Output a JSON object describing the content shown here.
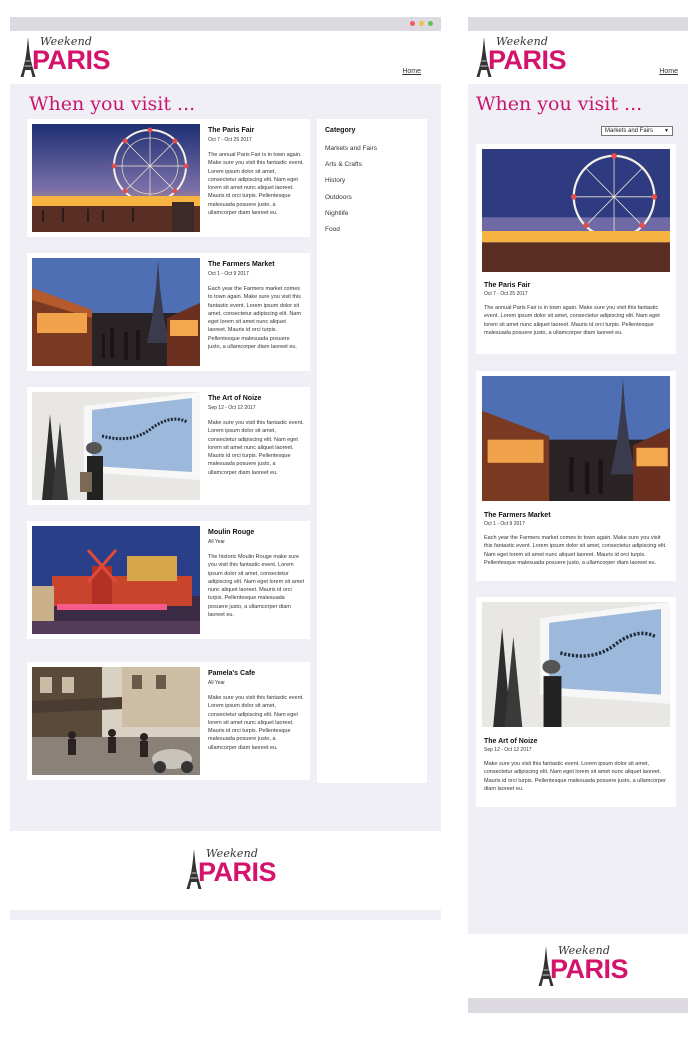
{
  "brand": {
    "logo_script": "Weekend",
    "logo_small": "in",
    "logo_main": "PARIS",
    "accent_color": "#d4136c"
  },
  "nav": {
    "home_label": "Home"
  },
  "heading": "When you visit ...",
  "sidebar": {
    "title": "Category",
    "items": [
      "Markets and Fairs",
      "Arts & Crafts",
      "History",
      "Outdoors",
      "Nightlife",
      "Food"
    ]
  },
  "category_select": {
    "selected": "Markets and Fairs"
  },
  "events": [
    {
      "title": "The Paris Fair",
      "date": "Oct 7 - Oct 25 2017",
      "desc": "The annual Paris Fair is in town again. Make sure you visit this fantastic event. Lorem ipsum dolor sit amet, consectetur adipiscing elit. Nam eget lorem sit amet nunc aliquet laoreet. Mauris id orci turpis. Pellentesque malesuada posuere justo, a ullamcorper diam laoreet eu.",
      "image": "ferris-wheel-fair-photo"
    },
    {
      "title": "The Farmers Market",
      "date": "Oct 1 - Oct 9 2017",
      "desc": "Each year the Farmers market comes to town again. Make sure you visit this fantastic event. Lorem ipsum dolor sit amet, consectetur adipiscing elit. Nam eget lorem sit amet nunc aliquet laoreet. Mauris id orci turpis. Pellentesque malesuada posuere justo, a ullamcorper diam laoreet eu.",
      "image": "eiffel-market-photo"
    },
    {
      "title": "The Art of Noize",
      "date": "Sep 12 - Oct 12 2017",
      "desc": "Make sure you visit this fantastic event. Lorem ipsum dolor sit amet, consectetur adipiscing elit. Nam eget lorem sit amet nunc aliquet laoreet. Mauris id orci turpis. Pellentesque malesuada posuere justo, a ullamcorper diam laoreet eu.",
      "image": "art-gallery-photo"
    },
    {
      "title": "Moulin Rouge",
      "date": "All Year",
      "desc": "The historic Moulin Rouge make sure you visit this fantastic event. Lorem ipsum dolor sit amet, consectetur adipiscing elit. Nam eget lorem sit amet nunc aliquet laoreet. Mauris id orci turpis. Pellentesque malesuada posuere justo, a ullamcorper diam laoreet eu.",
      "image": "moulin-rouge-photo"
    },
    {
      "title": "Pamela's Cafe",
      "date": "All Year",
      "desc": "Make sure you visit this fantastic event. Lorem ipsum dolor sit amet, consectetur adipiscing elit. Nam eget lorem sit amet nunc aliquet laoreet. Mauris id orci turpis. Pellentesque malesuada posuere justo, a ullamcorper diam laoreet eu.",
      "image": "street-cafe-photo"
    }
  ]
}
